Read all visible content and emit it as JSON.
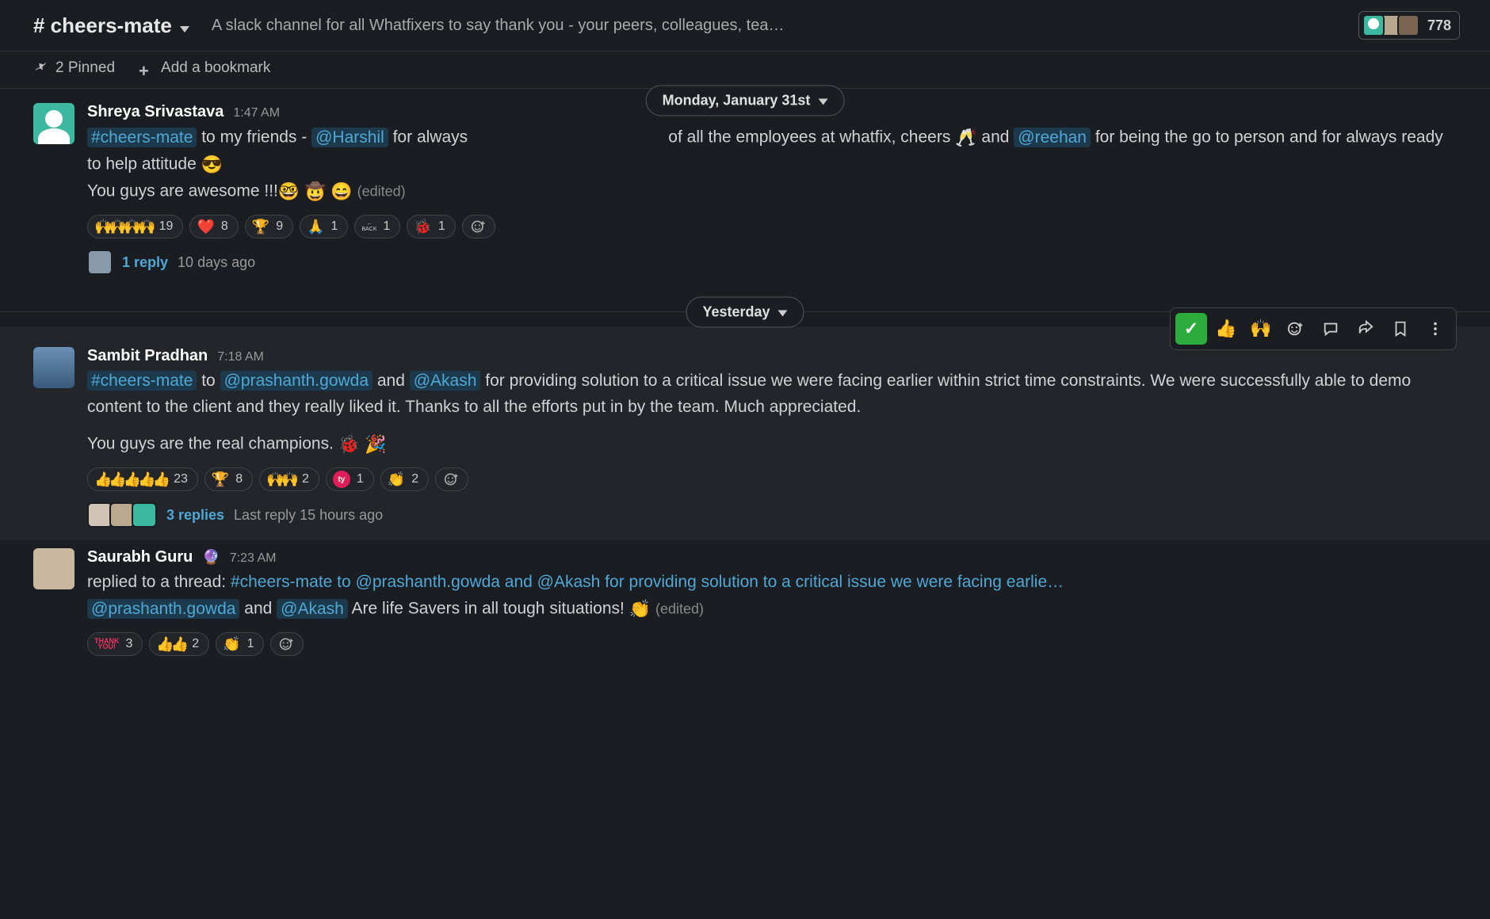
{
  "header": {
    "channel_name": "# cheers-mate",
    "topic": "A slack channel for all Whatfixers to say thank you - your peers, colleagues, tea…",
    "member_count": "778"
  },
  "subheader": {
    "pinned_label": "2 Pinned",
    "add_bookmark_label": "Add a bookmark"
  },
  "dividers": {
    "d1": "Monday, January 31st",
    "d2": "Yesterday"
  },
  "messages": [
    {
      "author": "Shreya Srivastava",
      "time": "1:47 AM",
      "channel_tag": "#cheers-mate",
      "text_a": " to my friends - ",
      "mention1": "@Harshil",
      "text_b": " for always ",
      "text_b2": " of all the employees at whatfix, cheers ",
      "text_c": " and ",
      "mention2": "@reehan",
      "text_d": " for being the go to person and for always ready to help attitude ",
      "line2": "You guys are awesome !!!",
      "edited": "(edited)",
      "reactions": [
        {
          "emoji": "🙌🙌🙌🙌",
          "count": "19"
        },
        {
          "emoji": "❤️",
          "count": "8"
        },
        {
          "emoji": "🏆",
          "count": "9"
        },
        {
          "emoji": "🙏",
          "count": "1"
        },
        {
          "emoji": "🔙",
          "count": "1",
          "back": true
        },
        {
          "emoji": "🐞",
          "count": "1"
        }
      ],
      "reply_count": "1 reply",
      "reply_time": "10 days ago"
    },
    {
      "author": "Sambit Pradhan",
      "time": "7:18 AM",
      "channel_tag": "#cheers-mate",
      "text_a": " to ",
      "mention1": "@prashanth.gowda",
      "text_b": " and ",
      "mention2": "@Akash",
      "text_c": " for providing solution to a critical issue we were facing earlier within strict time constraints. We were successfully able to demo content to the client and they really liked it. Thanks to all the efforts put in by the team. Much appreciated.",
      "line2": "You guys are the real champions. ",
      "reactions": [
        {
          "emoji": "👍👍👍👍👍",
          "count": "23"
        },
        {
          "emoji": "🏆",
          "count": "8"
        },
        {
          "emoji": "🙌🙌",
          "count": "2"
        },
        {
          "emoji": "ty",
          "count": "1",
          "heart": true
        },
        {
          "emoji": "👏",
          "count": "2"
        }
      ],
      "reply_count": "3 replies",
      "reply_time": "Last reply 15 hours ago"
    },
    {
      "author": "Saurabh Guru",
      "time": "7:23 AM",
      "replied_prefix": "replied to a thread: ",
      "thread_link": "#cheers-mate to @prashanth.gowda and @Akash for providing solution to a critical issue we were facing earlie…",
      "mention1": "@prashanth.gowda",
      "text_a": " and ",
      "mention2": "@Akash",
      "text_b": " Are life Savers in all tough situations! ",
      "edited": "(edited)",
      "reactions": [
        {
          "emoji": "THANK YOU!",
          "count": "3",
          "thank": true
        },
        {
          "emoji": "👍👍",
          "count": "2"
        },
        {
          "emoji": "👏",
          "count": "1"
        }
      ]
    }
  ],
  "hover_actions": {
    "check": "✓",
    "thumbs": "👍",
    "raised": "🙌"
  }
}
